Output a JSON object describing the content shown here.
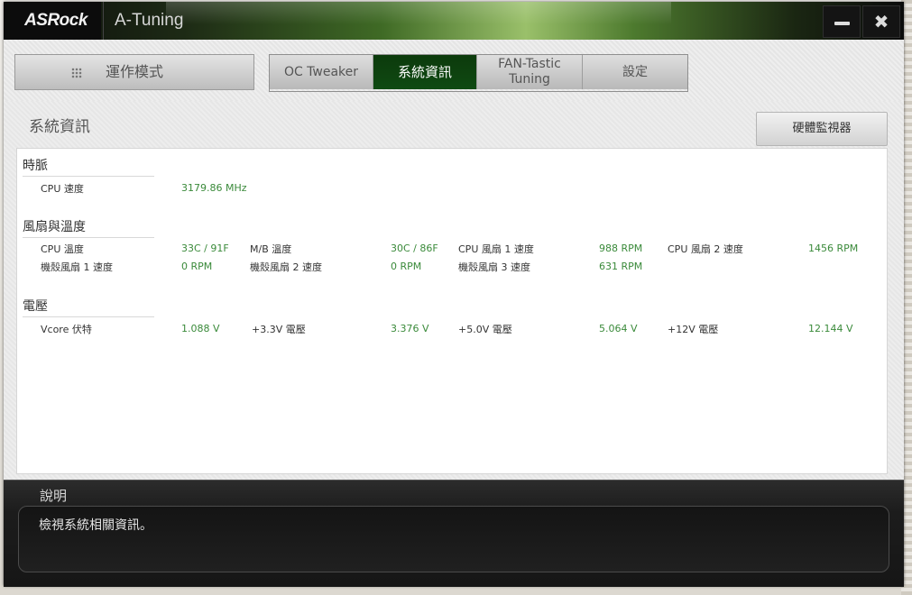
{
  "app": {
    "brand": "ASRock",
    "title": "A-Tuning",
    "minimize_icon": "minimize-icon",
    "close_icon": "close-icon"
  },
  "nav": {
    "mode_icon": "grid-icon",
    "mode_label": "運作模式",
    "tabs": [
      {
        "label": "OC Tweaker",
        "active": false
      },
      {
        "label": "系統資訊",
        "active": true
      },
      {
        "label": "FAN-Tastic\nTuning",
        "active": false
      },
      {
        "label": "設定",
        "active": false
      }
    ]
  },
  "main": {
    "page_title": "系統資訊",
    "hw_monitor_button": "硬體監視器",
    "sections": [
      {
        "title": "時脈",
        "items": [
          {
            "label": "CPU 速度",
            "value": "3179.86 MHz"
          }
        ]
      },
      {
        "title": "風扇與溫度",
        "items": [
          {
            "label": "CPU 溫度",
            "value": "33C / 91F"
          },
          {
            "label": "M/B 溫度",
            "value": "30C / 86F"
          },
          {
            "label": "CPU 風扇 1 速度",
            "value": "988 RPM"
          },
          {
            "label": "CPU 風扇 2 速度",
            "value": "1456 RPM"
          },
          {
            "label": "機殼風扇 1 速度",
            "value": "0 RPM"
          },
          {
            "label": "機殼風扇 2 速度",
            "value": "0 RPM"
          },
          {
            "label": "機殼風扇 3 速度",
            "value": "631 RPM"
          }
        ]
      },
      {
        "title": "電壓",
        "items": [
          {
            "label": "Vcore 伏特",
            "value": "1.088 V"
          },
          {
            "label": "+3.3V 電壓",
            "value": "3.376 V"
          },
          {
            "label": "+5.0V 電壓",
            "value": "5.064 V"
          },
          {
            "label": "+12V 電壓",
            "value": "12.144 V"
          }
        ]
      }
    ]
  },
  "description": {
    "title": "說明",
    "text": "檢視系統相關資訊。"
  },
  "colors": {
    "value_green": "#3a8a3a",
    "active_tab": "#0f4a12",
    "title_bar_accent": "#9ac06a"
  }
}
